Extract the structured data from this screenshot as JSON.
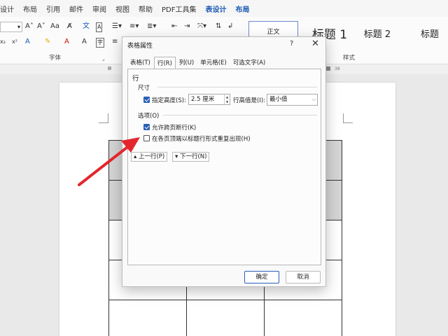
{
  "menu": {
    "items": [
      "设计",
      "布局",
      "引用",
      "邮件",
      "审阅",
      "视图",
      "帮助",
      "PDF工具集",
      "表设计",
      "布局"
    ]
  },
  "ribbon": {
    "font_group_label": "字体",
    "styles_group_label": "样式",
    "styles": [
      "正文",
      "标题 1",
      "标题 2",
      "标题"
    ],
    "ruler_ticks": [
      "38"
    ]
  },
  "dialog": {
    "title": "表格属性",
    "help": "?",
    "close": "✕",
    "tabs": [
      "表格(T)",
      "行(R)",
      "列(U)",
      "单元格(E)",
      "可选文字(A)"
    ],
    "active_tab": "行(R)",
    "section_row": "行",
    "section_size": "尺寸",
    "specify_height_label": "指定高度(S):",
    "specify_height_checked": true,
    "height_value": "2.5 厘米",
    "height_rule_label": "行高值是(I):",
    "height_rule_value": "最小值",
    "section_options": "选项(O)",
    "allow_break_label": "允许跨页断行(K)",
    "allow_break_checked": true,
    "repeat_header_label": "在各页顶端以标题行形式重复出现(H)",
    "repeat_header_checked": false,
    "prev_row_label": "上一行(P)",
    "next_row_label": "下一行(N)",
    "ok_label": "确定",
    "cancel_label": "取消"
  },
  "colors": {
    "accent": "#1b5ab5",
    "checkbox": "#2a5fb7",
    "arrow": "#e3262b",
    "table_shading": "#d4d4d4"
  }
}
